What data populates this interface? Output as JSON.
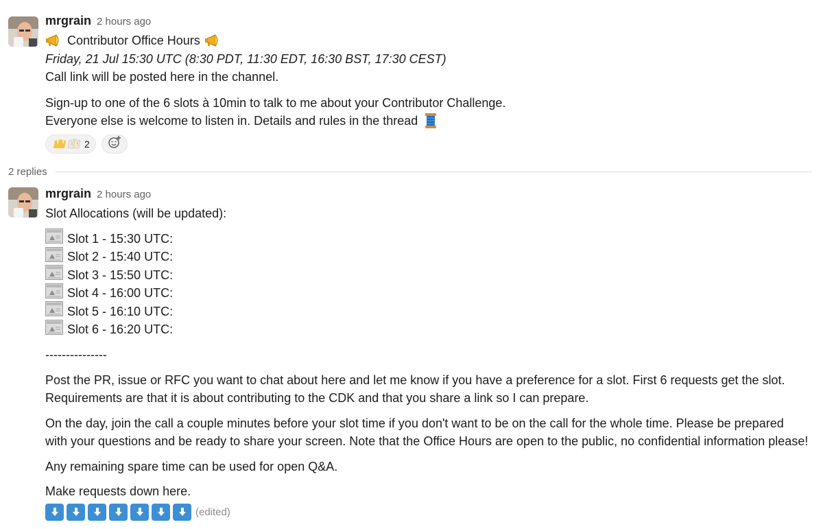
{
  "messages": [
    {
      "author": "mrgrain",
      "time": "2 hours ago",
      "title": "Contributor Office Hours",
      "lines": [
        "Friday, 21 Jul 15:30 UTC (8:30 PDT, 11:30 EDT, 16:30 BST, 17:30 CEST)",
        "Call link will be posted here in the channel.",
        "Sign-up to one of the 6 slots à 10min to talk to me about your Contributor Challenge.",
        "Everyone else is welcome to listen in. Details and rules in the thread"
      ],
      "reaction_count": "2"
    }
  ],
  "thread": {
    "replies_label": "2 replies",
    "reply": {
      "author": "mrgrain",
      "time": "2 hours ago",
      "heading": "Slot Allocations (will be updated):",
      "slots": [
        "Slot 1 - 15:30 UTC:",
        "Slot 2 - 15:40 UTC:",
        "Slot 3 - 15:50 UTC:",
        "Slot 4 - 16:00 UTC:",
        "Slot 5 - 16:10 UTC:",
        "Slot 6 - 16:20 UTC:"
      ],
      "separator": "---------------",
      "paragraphs": [
        "Post the PR, issue or RFC you want to chat about here and let me know if you have a preference for a slot. First 6 requests get the slot.",
        "Requirements are that it is about contributing to the CDK and that you share a link so I can prepare.",
        "On the day, join the call a couple minutes before your slot time if you don't want to be on the call for the whole time. Please be prepared",
        "with your questions and be ready to share your screen. Note that the Office Hours are open to the public, no confidential information please!",
        "Any remaining spare time can be used for open Q&A.",
        "Make requests down here."
      ],
      "edited_label": "(edited)"
    }
  },
  "icons": {
    "title": "megaphone-icon",
    "thread": "spool-of-thread-icon",
    "reaction": "raising-hands-icon",
    "add_reaction": "add-reaction-icon",
    "slot": "ticket-placeholder-icon",
    "arrow": "down-arrow-icon"
  },
  "colors": {
    "text": "#1d1c1d",
    "muted": "#616061",
    "link_blue": "#3d8fd4"
  }
}
